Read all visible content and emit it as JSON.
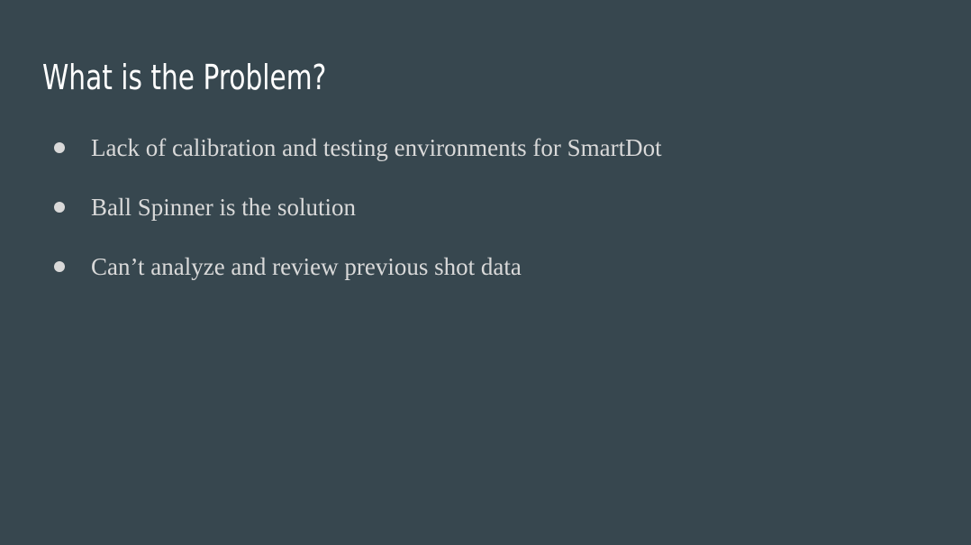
{
  "slide": {
    "title": "What is the Problem?",
    "bullets": [
      "Lack of calibration and testing environments for SmartDot",
      "Ball Spinner is the solution",
      "Can’t analyze and review previous shot data"
    ]
  },
  "colors": {
    "background": "#37474f",
    "title": "#ffffff",
    "body_text": "#d9d9d9"
  }
}
